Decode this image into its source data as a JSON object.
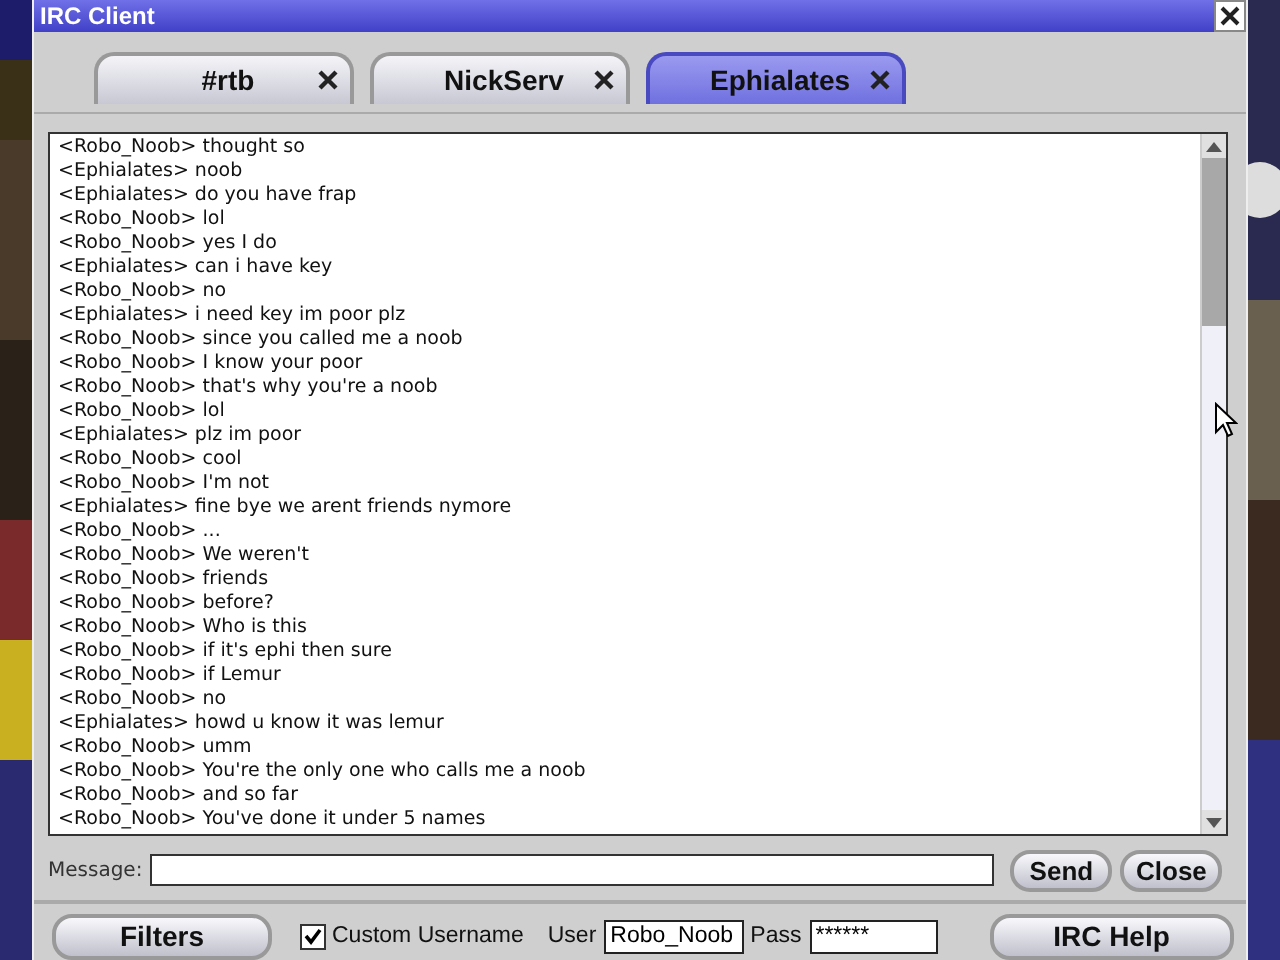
{
  "window": {
    "title": "IRC Client"
  },
  "tabs": [
    {
      "label": "#rtb",
      "selected": false
    },
    {
      "label": "NickServ",
      "selected": false
    },
    {
      "label": "Ephialates",
      "selected": true
    }
  ],
  "chat": {
    "lines": [
      "<Robo_Noob> thought so",
      "<Ephialates> noob",
      "<Ephialates> do you have frap",
      "<Robo_Noob> lol",
      "<Robo_Noob> yes I do",
      "<Ephialates> can i have key",
      "<Robo_Noob> no",
      "<Ephialates> i need key im poor plz",
      "<Robo_Noob> since you called me a noob",
      "<Robo_Noob> I know your poor",
      "<Robo_Noob> that's why you're a noob",
      "<Robo_Noob> lol",
      "<Ephialates> plz im poor",
      "<Robo_Noob> cool",
      "<Robo_Noob> I'm not",
      "<Ephialates> fine bye we arent friends nymore",
      "<Robo_Noob> ...",
      "<Robo_Noob> We weren't",
      "<Robo_Noob> friends",
      "<Robo_Noob> before?",
      "<Robo_Noob> Who is this",
      "<Robo_Noob> if it's ephi then sure",
      "<Robo_Noob> if Lemur",
      "<Robo_Noob> no",
      "<Ephialates> howd u know it was lemur",
      "<Robo_Noob> umm",
      "<Robo_Noob> You're the only one who calls me a noob",
      "<Robo_Noob> and so far",
      "<Robo_Noob> You've done it under 5 names"
    ]
  },
  "message": {
    "label": "Message:"
  },
  "buttons": [
    "Send",
    "Close"
  ],
  "footer": {
    "filters": "Filters",
    "custom_username": {
      "label": "Custom Username",
      "checked": true
    },
    "user": {
      "label": "User",
      "value": "Robo_Noob"
    },
    "pass": {
      "label": "Pass",
      "value": "******"
    },
    "help": "IRC Help"
  }
}
